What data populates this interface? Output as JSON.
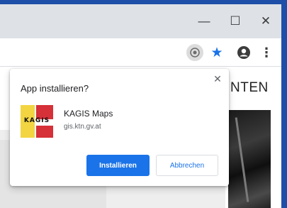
{
  "window_controls": {
    "minimize": "—",
    "maximize": "☐",
    "close": "✕"
  },
  "toolbar": {
    "icons": [
      "install-app-icon",
      "bookmark-star-icon",
      "account-icon",
      "more-menu-icon"
    ],
    "menu_glyph": "⋮",
    "star_glyph": "★"
  },
  "page": {
    "heading": "NTEN"
  },
  "install_dialog": {
    "title": "App installieren?",
    "close_glyph": "✕",
    "app": {
      "name": "KAGIS Maps",
      "url": "gis.ktn.gv.at",
      "logo_text": "KAGIS",
      "logo_colors": {
        "yellow": "#f2d541",
        "red": "#d63038"
      }
    },
    "install_label": "Installieren",
    "cancel_label": "Abbrechen"
  },
  "colors": {
    "accent": "#1a73e8",
    "titlebar": "#dee1e6",
    "desktop": "#1e4fa8"
  }
}
